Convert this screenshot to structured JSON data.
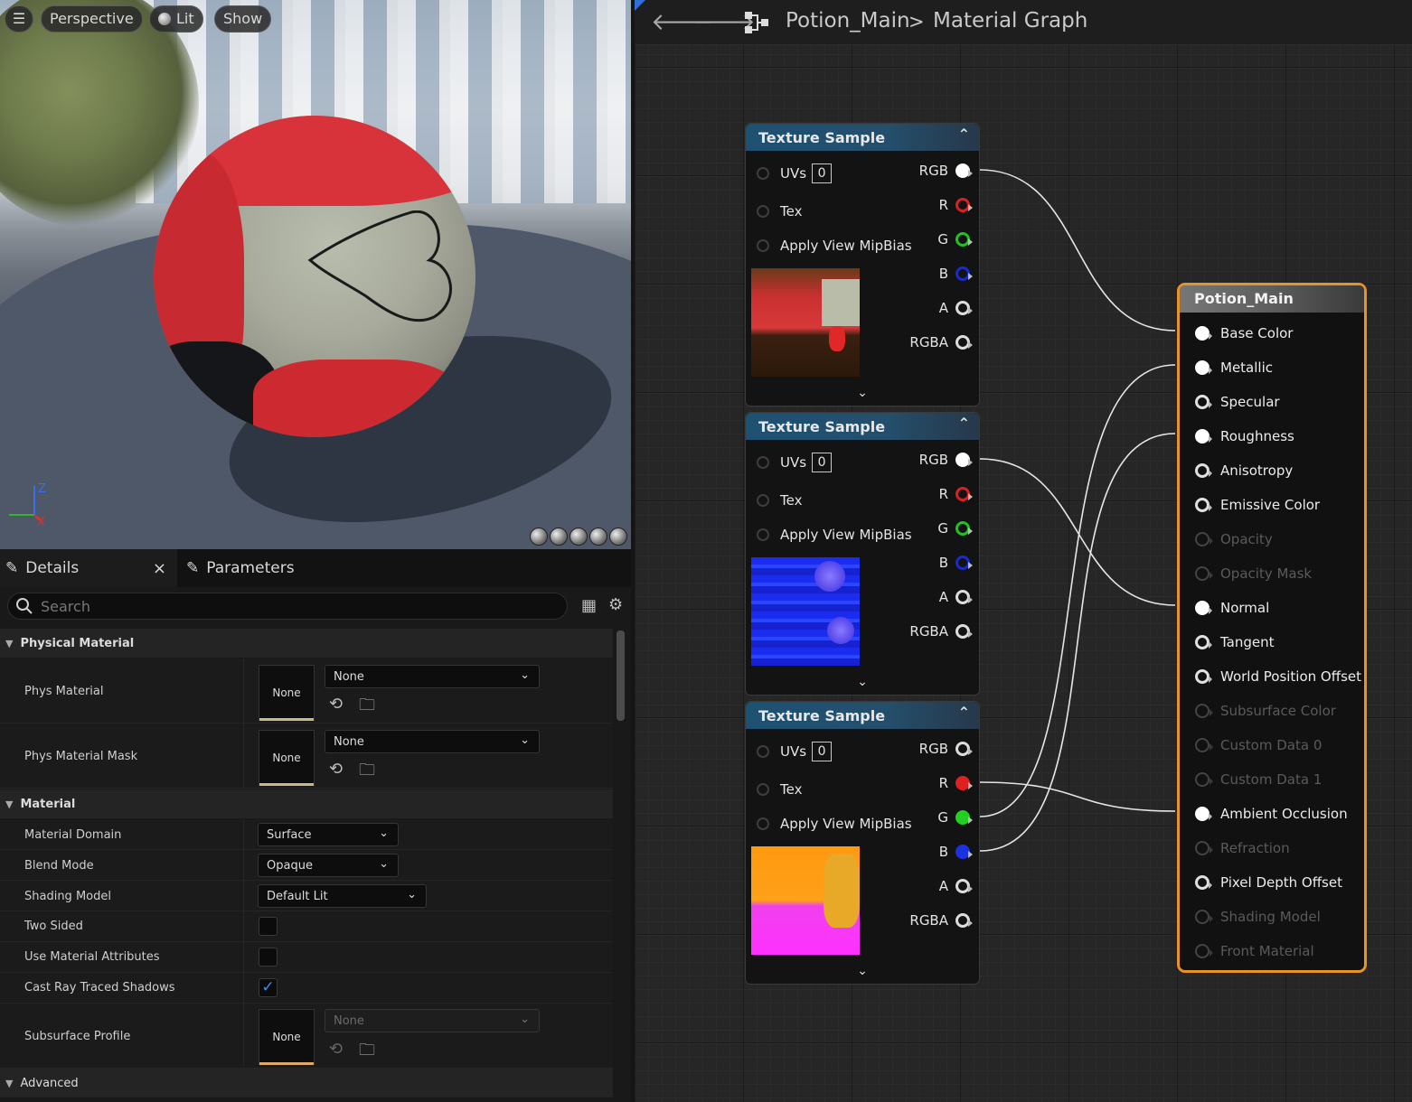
{
  "viewport": {
    "menu_icon": "hamburger-icon",
    "perspective_label": "Perspective",
    "lit_label": "Lit",
    "show_label": "Show",
    "axis_z": "Z",
    "axis_x": "X"
  },
  "graph": {
    "breadcrumb_asset": "Potion_Main",
    "breadcrumb_sep": ">",
    "breadcrumb_view": "Material Graph",
    "texture_nodes": [
      {
        "title": "Texture Sample",
        "uvs_label": "UVs",
        "uvs_value": "0",
        "tex_label": "Tex",
        "mip_label": "Apply View MipBias",
        "outputs": [
          "RGB",
          "R",
          "G",
          "B",
          "A",
          "RGBA"
        ]
      },
      {
        "title": "Texture Sample",
        "uvs_label": "UVs",
        "uvs_value": "0",
        "tex_label": "Tex",
        "mip_label": "Apply View MipBias",
        "outputs": [
          "RGB",
          "R",
          "G",
          "B",
          "A",
          "RGBA"
        ]
      },
      {
        "title": "Texture Sample",
        "uvs_label": "UVs",
        "uvs_value": "0",
        "tex_label": "Tex",
        "mip_label": "Apply View MipBias",
        "outputs": [
          "RGB",
          "R",
          "G",
          "B",
          "A",
          "RGBA"
        ]
      }
    ],
    "main_node": {
      "title": "Potion_Main",
      "pins": [
        {
          "label": "Base Color",
          "state": "connected"
        },
        {
          "label": "Metallic",
          "state": "connected"
        },
        {
          "label": "Specular",
          "state": "open"
        },
        {
          "label": "Roughness",
          "state": "connected"
        },
        {
          "label": "Anisotropy",
          "state": "open"
        },
        {
          "label": "Emissive Color",
          "state": "open"
        },
        {
          "label": "Opacity",
          "state": "disabled"
        },
        {
          "label": "Opacity Mask",
          "state": "disabled"
        },
        {
          "label": "Normal",
          "state": "connected"
        },
        {
          "label": "Tangent",
          "state": "open"
        },
        {
          "label": "World Position Offset",
          "state": "open"
        },
        {
          "label": "Subsurface Color",
          "state": "disabled"
        },
        {
          "label": "Custom Data 0",
          "state": "disabled"
        },
        {
          "label": "Custom Data 1",
          "state": "disabled"
        },
        {
          "label": "Ambient Occlusion",
          "state": "connected"
        },
        {
          "label": "Refraction",
          "state": "disabled"
        },
        {
          "label": "Pixel Depth Offset",
          "state": "open"
        },
        {
          "label": "Shading Model",
          "state": "disabled"
        },
        {
          "label": "Front Material",
          "state": "disabled"
        }
      ]
    },
    "colors": {
      "accent": "#e8922a",
      "pin_red": "#e02020",
      "pin_green": "#22d022",
      "pin_blue": "#1a32e0",
      "node_header": "#1d5172"
    }
  },
  "details": {
    "tab_details": "Details",
    "tab_close": "×",
    "tab_parameters": "Parameters",
    "search_placeholder": "Search",
    "cat_physical": "Physical Material",
    "phys_material_label": "Phys Material",
    "phys_material_thumb": "None",
    "phys_material_value": "None",
    "phys_mask_label": "Phys Material Mask",
    "phys_mask_thumb": "None",
    "phys_mask_value": "None",
    "cat_material": "Material",
    "domain_label": "Material Domain",
    "domain_value": "Surface",
    "blend_label": "Blend Mode",
    "blend_value": "Opaque",
    "shading_label": "Shading Model",
    "shading_value": "Default Lit",
    "two_sided_label": "Two Sided",
    "two_sided": false,
    "use_attr_label": "Use Material Attributes",
    "use_attr": false,
    "cast_rt_label": "Cast Ray Traced Shadows",
    "cast_rt": true,
    "check_mark": "✓",
    "subsurface_label": "Subsurface Profile",
    "subsurface_thumb": "None",
    "subsurface_value": "None",
    "cat_advanced": "Advanced"
  }
}
